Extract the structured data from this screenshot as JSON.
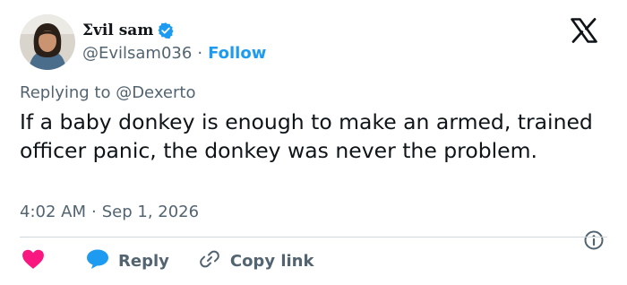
{
  "author": {
    "display_name": "Σvil sam",
    "handle": "@Evilsam036",
    "separator": "·",
    "follow_label": "Follow",
    "verified": true
  },
  "replying_to": "Replying to @Dexerto",
  "tweet_text": "If a baby donkey is enough to make an armed, trained officer panic, the donkey was never the problem.",
  "meta": {
    "time": "4:02 AM",
    "separator": "·",
    "date": "Sep 1, 2026"
  },
  "actions": {
    "reply_label": "Reply",
    "copy_link_label": "Copy link"
  },
  "icons": {
    "platform_logo": "x-logo-icon",
    "verified": "verified-badge-icon",
    "info": "info-icon",
    "like": "heart-icon",
    "reply": "reply-bubble-icon",
    "copy_link": "link-icon"
  },
  "colors": {
    "accent": "#1d9bf0",
    "like": "#f91880",
    "text": "#0f1419",
    "muted": "#536471",
    "divider": "#cfd9de"
  }
}
